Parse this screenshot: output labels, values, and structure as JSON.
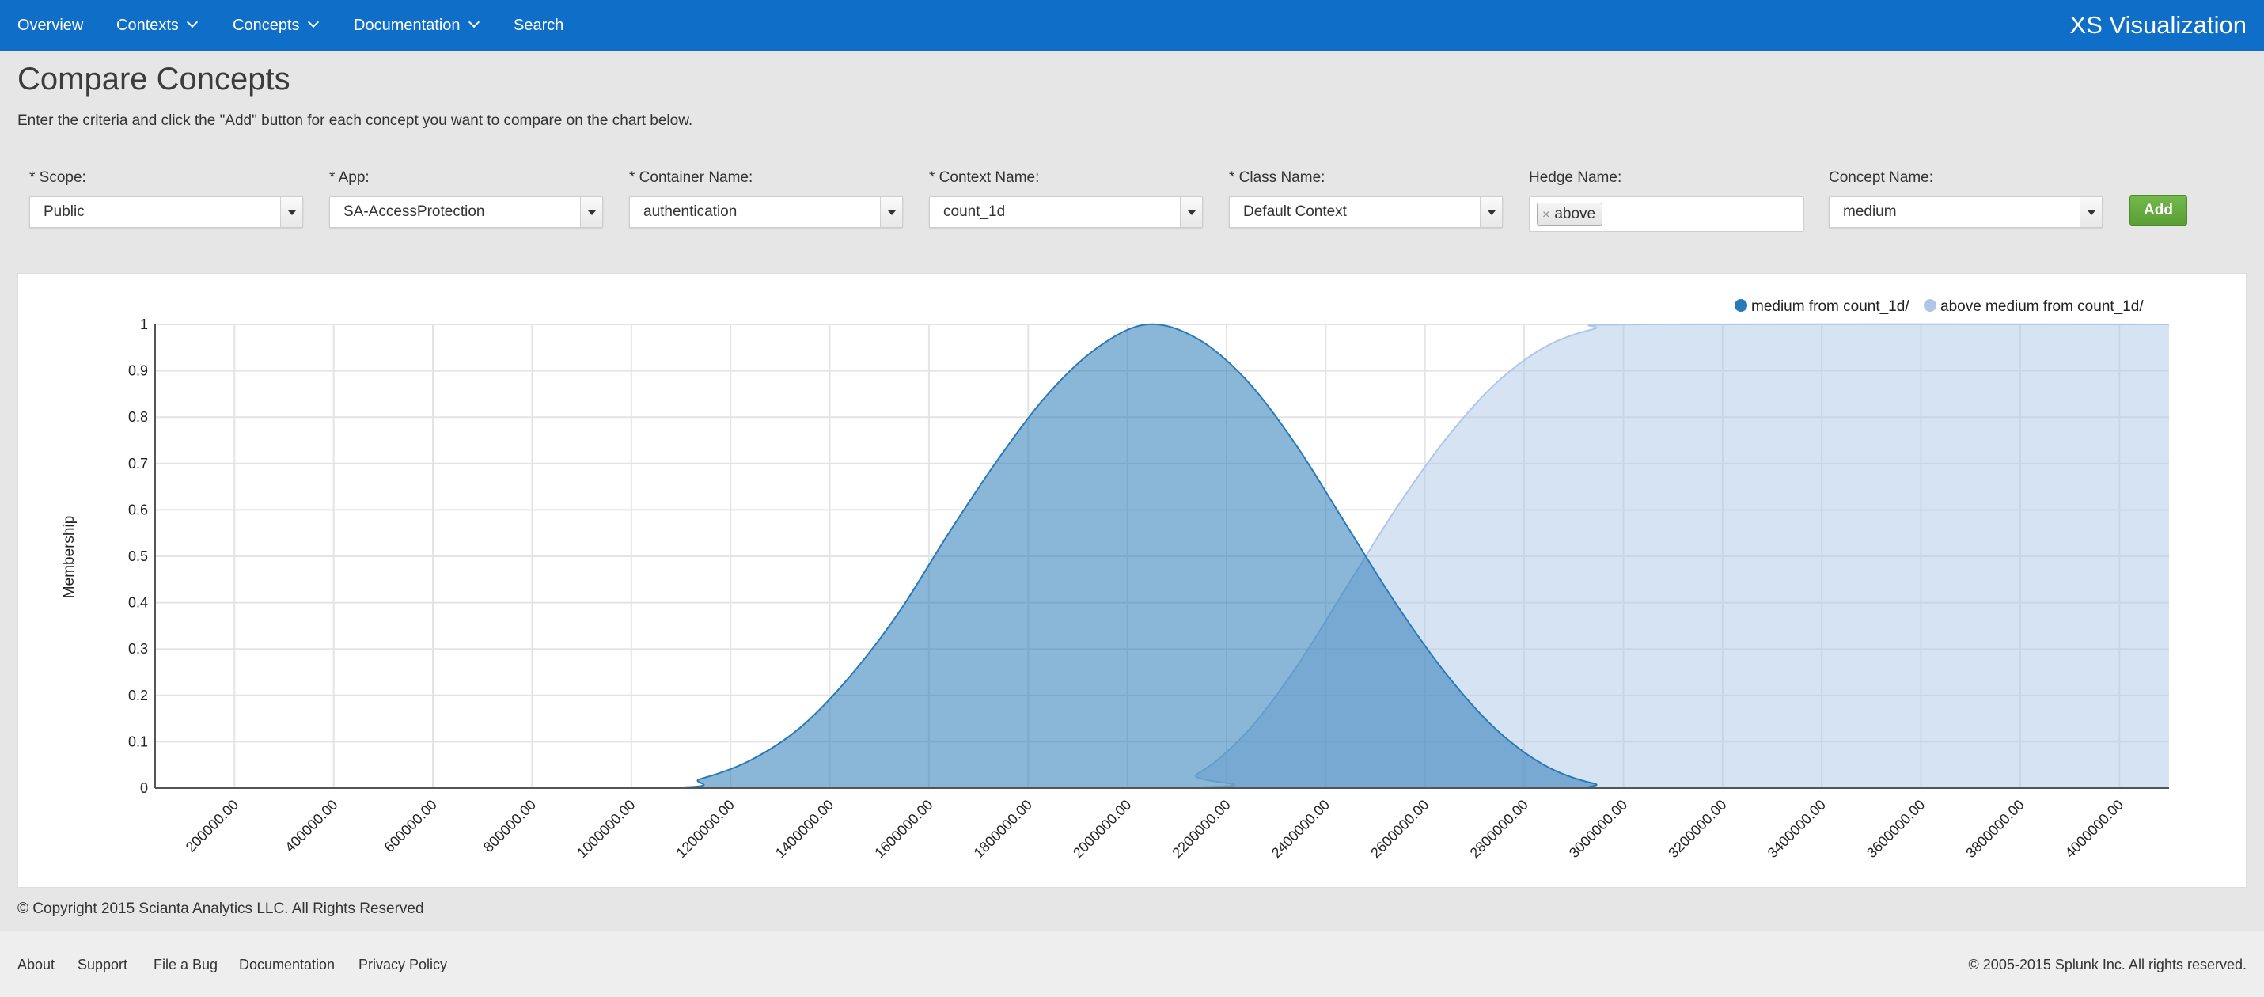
{
  "nav": {
    "overview": "Overview",
    "contexts": "Contexts",
    "concepts": "Concepts",
    "documentation": "Documentation",
    "search": "Search",
    "app_title": "XS Visualization"
  },
  "page": {
    "title": "Compare Concepts",
    "description": "Enter the criteria and click the \"Add\" button for each concept you want to compare on the chart below."
  },
  "form": {
    "scope": {
      "label": "* Scope:",
      "value": "Public"
    },
    "app": {
      "label": "* App:",
      "value": "SA-AccessProtection"
    },
    "container": {
      "label": "* Container Name:",
      "value": "authentication"
    },
    "context": {
      "label": "* Context Name:",
      "value": "count_1d"
    },
    "class_name": {
      "label": "* Class Name:",
      "value": "Default Context"
    },
    "hedge": {
      "label": "Hedge Name:",
      "token": "above",
      "remove_symbol": "×"
    },
    "concept": {
      "label": "Concept Name:",
      "value": "medium"
    },
    "add_label": "Add"
  },
  "chart_data": {
    "type": "area",
    "ylabel": "Membership",
    "xlabel": "",
    "ylim": [
      0,
      1
    ],
    "xlim": [
      40000,
      4100000
    ],
    "y_ticks": [
      "0",
      "0.1",
      "0.2",
      "0.3",
      "0.4",
      "0.5",
      "0.6",
      "0.7",
      "0.8",
      "0.9",
      "1"
    ],
    "x_ticks": [
      "200000.00",
      "400000.00",
      "600000.00",
      "800000.00",
      "1000000.00",
      "1200000.00",
      "1400000.00",
      "1600000.00",
      "1800000.00",
      "2000000.00",
      "2200000.00",
      "2400000.00",
      "2600000.00",
      "2800000.00",
      "3000000.00",
      "3200000.00",
      "3400000.00",
      "3600000.00",
      "3800000.00",
      "4000000.00"
    ],
    "grid": true,
    "legend_position": "top-right",
    "series": [
      {
        "name": "medium from count_1d/",
        "color": "#2a7ab8",
        "x": [
          40000,
          1040000,
          1140000,
          1240000,
          1340000,
          1440000,
          1540000,
          1640000,
          1740000,
          1840000,
          1940000,
          2040000,
          2140000,
          2240000,
          2340000,
          2440000,
          2540000,
          2640000,
          2740000,
          2840000,
          2940000,
          3040000,
          4100000
        ],
        "y": [
          0,
          0,
          0.02,
          0.06,
          0.13,
          0.24,
          0.38,
          0.55,
          0.71,
          0.85,
          0.95,
          1.0,
          0.97,
          0.88,
          0.74,
          0.57,
          0.4,
          0.25,
          0.13,
          0.05,
          0.01,
          0,
          0
        ]
      },
      {
        "name": "above medium from count_1d/",
        "color": "#aec7e8",
        "x": [
          40000,
          2040000,
          2140000,
          2240000,
          2340000,
          2440000,
          2540000,
          2640000,
          2740000,
          2840000,
          2940000,
          3040000,
          4100000
        ],
        "y": [
          0,
          0,
          0.03,
          0.12,
          0.26,
          0.43,
          0.6,
          0.75,
          0.87,
          0.95,
          0.99,
          1.0,
          1.0
        ]
      }
    ]
  },
  "footer": {
    "copyright": "© Copyright 2015 Scianta Analytics LLC. All Rights Reserved",
    "links": {
      "about": "About",
      "support": "Support",
      "file_bug": "File a Bug",
      "documentation": "Documentation",
      "privacy": "Privacy Policy"
    },
    "splunk": "© 2005-2015 Splunk Inc. All rights reserved."
  }
}
